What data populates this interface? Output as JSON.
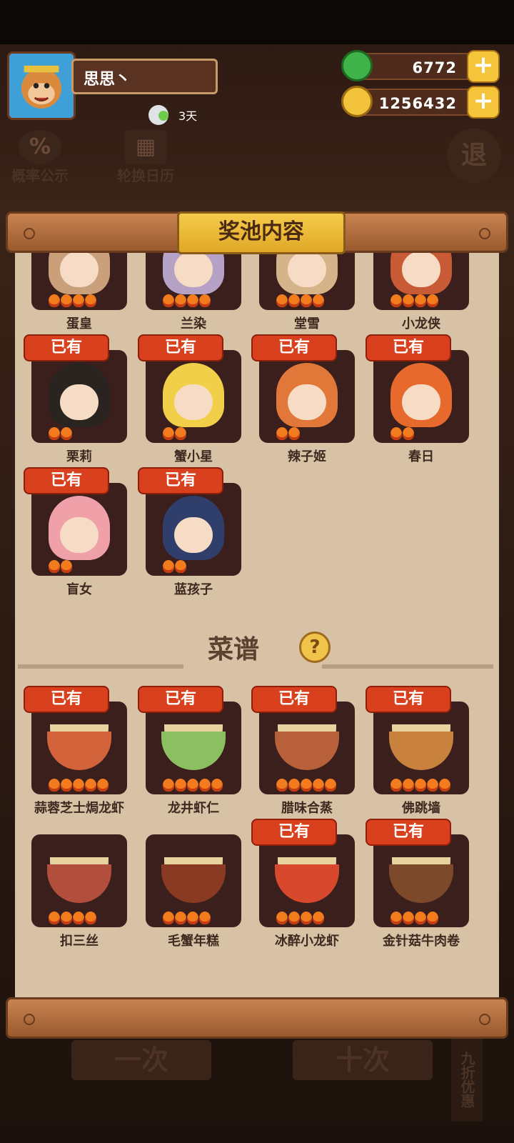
{
  "profile": {
    "name": "思思丶",
    "days": "3天"
  },
  "currency": {
    "jade": "6772",
    "coins": "1256432"
  },
  "side": {
    "prob_label": "概率公示",
    "prob_sym": "%",
    "calendar_label": "轮换日历",
    "exit_label": "退"
  },
  "dialog": {
    "title": "奖池内容",
    "owned_label": "已有",
    "characters": [
      {
        "name": "蛋皇",
        "owned": false,
        "flames": 4,
        "color": "#c9a07a"
      },
      {
        "name": "兰染",
        "owned": false,
        "flames": 4,
        "color": "#b5a2c6"
      },
      {
        "name": "堂雪",
        "owned": false,
        "flames": 4,
        "color": "#d6b489"
      },
      {
        "name": "小龙侠",
        "owned": false,
        "flames": 4,
        "color": "#c85a36"
      },
      {
        "name": "栗莉",
        "owned": true,
        "flames": 2,
        "color": "#2a2421"
      },
      {
        "name": "蟹小星",
        "owned": true,
        "flames": 2,
        "color": "#f1cf48"
      },
      {
        "name": "辣子姬",
        "owned": true,
        "flames": 2,
        "color": "#e1783a"
      },
      {
        "name": "春日",
        "owned": true,
        "flames": 2,
        "color": "#e8692c"
      },
      {
        "name": "盲女",
        "owned": true,
        "flames": 2,
        "color": "#f0a0a8"
      },
      {
        "name": "蓝孩子",
        "owned": true,
        "flames": 2,
        "color": "#2f3e6b"
      }
    ],
    "recipe_title": "菜谱",
    "recipes": [
      {
        "name": "蒜蓉芝士焗龙虾",
        "owned": true,
        "flames": 5,
        "color": "#d3633a"
      },
      {
        "name": "龙井虾仁",
        "owned": true,
        "flames": 5,
        "color": "#8cbf62"
      },
      {
        "name": "腊味合蒸",
        "owned": true,
        "flames": 5,
        "color": "#b8603a"
      },
      {
        "name": "佛跳墙",
        "owned": true,
        "flames": 5,
        "color": "#c9813e"
      },
      {
        "name": "扣三丝",
        "owned": false,
        "flames": 4,
        "color": "#b14f3c"
      },
      {
        "name": "毛蟹年糕",
        "owned": false,
        "flames": 4,
        "color": "#8a3a22"
      },
      {
        "name": "冰醉小龙虾",
        "owned": true,
        "flames": 4,
        "color": "#d8482c"
      },
      {
        "name": "金针菇牛肉卷",
        "owned": true,
        "flames": 4,
        "color": "#7c4a2a"
      }
    ]
  },
  "bottom": {
    "single": "一次",
    "ten": "十次",
    "discount": "九折优惠"
  },
  "colors": {
    "owned_badge": "#d8401e",
    "panel": "#d8c2a5",
    "card": "#3a1f1c",
    "gold": "#f4c43a"
  }
}
